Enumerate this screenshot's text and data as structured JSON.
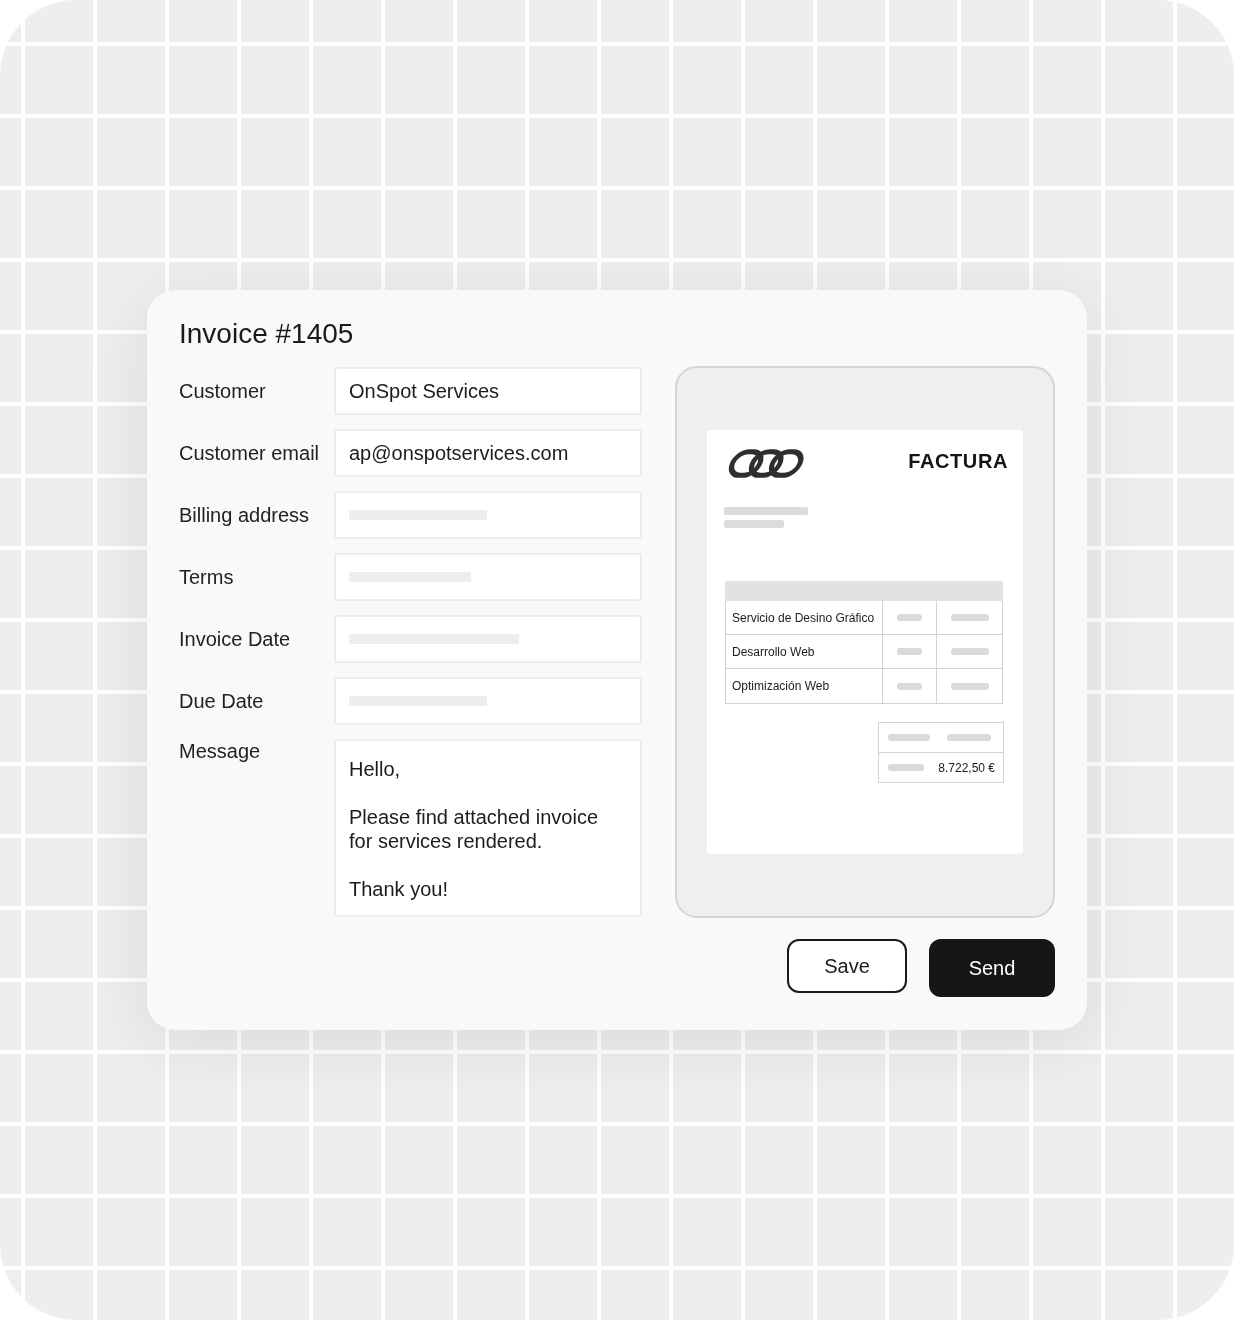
{
  "invoice": {
    "title": "Invoice #1405",
    "fields": [
      {
        "label": "Customer",
        "kind": "text",
        "value": "OnSpot Services"
      },
      {
        "label": "Customer email",
        "kind": "text",
        "value": "ap@onspotservices.com"
      },
      {
        "label": "Billing address",
        "kind": "skeleton"
      },
      {
        "label": "Terms",
        "kind": "skeleton"
      },
      {
        "label": "Invoice Date",
        "kind": "skeleton"
      },
      {
        "label": "Due Date",
        "kind": "skeleton"
      },
      {
        "label": "Message",
        "kind": "textarea",
        "value": "Hello,\n\nPlease find attached invoice\nfor services rendered.\n\nThank you!"
      }
    ]
  },
  "preview": {
    "heading": "FACTURA",
    "line_items": [
      "Servicio de Desino Gráfico",
      "Desarrollo Web",
      "Optimización Web"
    ],
    "total": "8.722,50 €"
  },
  "buttons": [
    {
      "label": "Save",
      "kind": "secondary"
    },
    {
      "label": "Send",
      "kind": "primary"
    }
  ]
}
